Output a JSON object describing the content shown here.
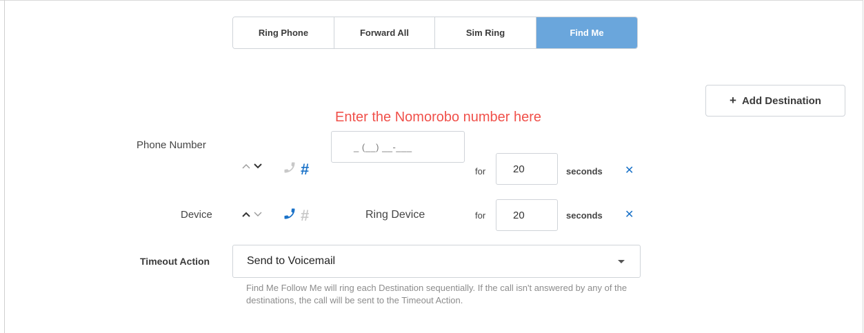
{
  "tabs": [
    {
      "label": "Ring Phone",
      "active": false
    },
    {
      "label": "Forward All",
      "active": false
    },
    {
      "label": "Sim Ring",
      "active": false
    },
    {
      "label": "Find Me",
      "active": true
    }
  ],
  "add_destination": {
    "icon": "plus-icon",
    "label": "Add Destination"
  },
  "annotation": "Enter the Nomorobo number here",
  "rows": {
    "phone": {
      "label": "Phone Number",
      "input_placeholder": "_ (__) __-___",
      "for_label": "for",
      "seconds_value": "20",
      "seconds_label": "seconds",
      "remove_icon": "close-icon"
    },
    "device": {
      "label": "Device",
      "device_value": "Ring Device",
      "for_label": "for",
      "seconds_value": "20",
      "seconds_label": "seconds",
      "remove_icon": "close-icon"
    }
  },
  "timeout": {
    "label": "Timeout Action",
    "selected": "Send to Voicemail",
    "help": "Find Me Follow Me will ring each Destination sequentially. If the call isn't answered by any of the destinations, the call will be sent to the Timeout Action."
  },
  "colors": {
    "accent": "#1a72c8",
    "active_tab": "#6aa6dc",
    "annotation": "#f0504a"
  }
}
